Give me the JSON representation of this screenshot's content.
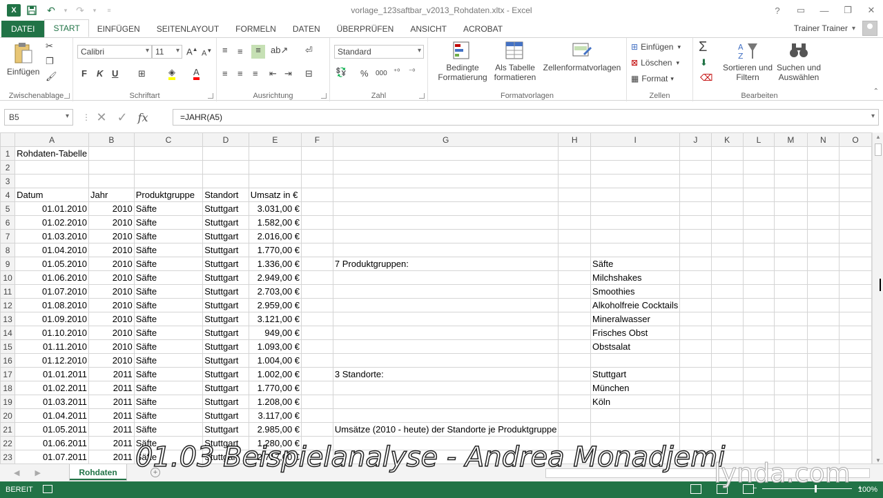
{
  "window": {
    "title": "vorlage_123saftbar_v2013_Rohdaten.xltx - Excel",
    "app_logo": "X",
    "controls": [
      "?",
      "▭",
      "—",
      "❐",
      "✕"
    ]
  },
  "ribbon_tabs": [
    "DATEI",
    "START",
    "EINFÜGEN",
    "SEITENLAYOUT",
    "FORMELN",
    "DATEN",
    "ÜBERPRÜFEN",
    "ANSICHT",
    "ACROBAT"
  ],
  "user": {
    "name": "Trainer Trainer"
  },
  "ribbon": {
    "clipboard": {
      "paste_label": "Einfügen",
      "group_label": "Zwischenablage"
    },
    "font": {
      "family": "Calibri",
      "size": "11",
      "bold": "F",
      "italic": "K",
      "underline": "U",
      "group_label": "Schriftart"
    },
    "alignment": {
      "group_label": "Ausrichtung"
    },
    "number": {
      "format": "Standard",
      "percent": "%",
      "thousands": "000",
      "group_label": "Zahl"
    },
    "styles": {
      "cond_format_1": "Bedingte",
      "cond_format_2": "Formatierung",
      "table_1": "Als Tabelle",
      "table_2": "formatieren",
      "cell_styles": "Zellenformatvorlagen",
      "group_label": "Formatvorlagen"
    },
    "cells": {
      "insert": "Einfügen",
      "delete": "Löschen",
      "format": "Format",
      "group_label": "Zellen"
    },
    "editing": {
      "sort_1": "Sortieren und",
      "sort_2": "Filtern",
      "find_1": "Suchen und",
      "find_2": "Auswählen",
      "group_label": "Bearbeiten"
    }
  },
  "formula_bar": {
    "name_box": "B5",
    "formula": "=JAHR(A5)",
    "cancel": "✕",
    "confirm": "✓",
    "fx": "fx"
  },
  "columns": [
    "A",
    "B",
    "C",
    "D",
    "E",
    "F",
    "G",
    "H",
    "I",
    "J",
    "K",
    "L",
    "M",
    "N",
    "O"
  ],
  "rows": [
    {
      "n": "1",
      "A": "Rohdaten-Tabelle"
    },
    {
      "n": "2"
    },
    {
      "n": "3"
    },
    {
      "n": "4",
      "A": "Datum",
      "B": "Jahr",
      "C": "Produktgruppe",
      "D": "Standort",
      "E": "Umsatz in €"
    },
    {
      "n": "5",
      "A": "01.01.2010",
      "B": "2010",
      "C": "Säfte",
      "D": "Stuttgart",
      "E": "3.031,00 €"
    },
    {
      "n": "6",
      "A": "01.02.2010",
      "B": "2010",
      "C": "Säfte",
      "D": "Stuttgart",
      "E": "1.582,00 €"
    },
    {
      "n": "7",
      "A": "01.03.2010",
      "B": "2010",
      "C": "Säfte",
      "D": "Stuttgart",
      "E": "2.016,00 €"
    },
    {
      "n": "8",
      "A": "01.04.2010",
      "B": "2010",
      "C": "Säfte",
      "D": "Stuttgart",
      "E": "1.770,00 €"
    },
    {
      "n": "9",
      "A": "01.05.2010",
      "B": "2010",
      "C": "Säfte",
      "D": "Stuttgart",
      "E": "1.336,00 €",
      "G": "7 Produktgruppen:",
      "I": "Säfte"
    },
    {
      "n": "10",
      "A": "01.06.2010",
      "B": "2010",
      "C": "Säfte",
      "D": "Stuttgart",
      "E": "2.949,00 €",
      "I": "Milchshakes"
    },
    {
      "n": "11",
      "A": "01.07.2010",
      "B": "2010",
      "C": "Säfte",
      "D": "Stuttgart",
      "E": "2.703,00 €",
      "I": "Smoothies"
    },
    {
      "n": "12",
      "A": "01.08.2010",
      "B": "2010",
      "C": "Säfte",
      "D": "Stuttgart",
      "E": "2.959,00 €",
      "I": "Alkoholfreie Cocktails"
    },
    {
      "n": "13",
      "A": "01.09.2010",
      "B": "2010",
      "C": "Säfte",
      "D": "Stuttgart",
      "E": "3.121,00 €",
      "I": "Mineralwasser"
    },
    {
      "n": "14",
      "A": "01.10.2010",
      "B": "2010",
      "C": "Säfte",
      "D": "Stuttgart",
      "E": "949,00 €",
      "I": "Frisches Obst"
    },
    {
      "n": "15",
      "A": "01.11.2010",
      "B": "2010",
      "C": "Säfte",
      "D": "Stuttgart",
      "E": "1.093,00 €",
      "I": "Obstsalat"
    },
    {
      "n": "16",
      "A": "01.12.2010",
      "B": "2010",
      "C": "Säfte",
      "D": "Stuttgart",
      "E": "1.004,00 €"
    },
    {
      "n": "17",
      "A": "01.01.2011",
      "B": "2011",
      "C": "Säfte",
      "D": "Stuttgart",
      "E": "1.002,00 €",
      "G": "3 Standorte:",
      "I": "Stuttgart"
    },
    {
      "n": "18",
      "A": "01.02.2011",
      "B": "2011",
      "C": "Säfte",
      "D": "Stuttgart",
      "E": "1.770,00 €",
      "I": "München"
    },
    {
      "n": "19",
      "A": "01.03.2011",
      "B": "2011",
      "C": "Säfte",
      "D": "Stuttgart",
      "E": "1.208,00 €",
      "I": "Köln"
    },
    {
      "n": "20",
      "A": "01.04.2011",
      "B": "2011",
      "C": "Säfte",
      "D": "Stuttgart",
      "E": "3.117,00 €"
    },
    {
      "n": "21",
      "A": "01.05.2011",
      "B": "2011",
      "C": "Säfte",
      "D": "Stuttgart",
      "E": "2.985,00 €",
      "G": "Umsätze (2010 - heute) der Standorte je Produktgruppe"
    },
    {
      "n": "22",
      "A": "01.06.2011",
      "B": "2011",
      "C": "Säfte",
      "D": "Stuttgart",
      "E": "1.280,00 €"
    },
    {
      "n": "23",
      "A": "01.07.2011",
      "B": "2011",
      "C": "Säfte",
      "D": "Stuttgart",
      "E": "2.717,00 €"
    }
  ],
  "sheet_tabs": {
    "active": "Rohdaten",
    "add": "+"
  },
  "status": {
    "mode": "BEREIT",
    "zoom": "100%"
  },
  "overlay": {
    "title": "01.03 Beispielanalyse - Andrea Monadjemi",
    "brand": "lynda.com"
  },
  "colors": {
    "accent": "#217346"
  }
}
